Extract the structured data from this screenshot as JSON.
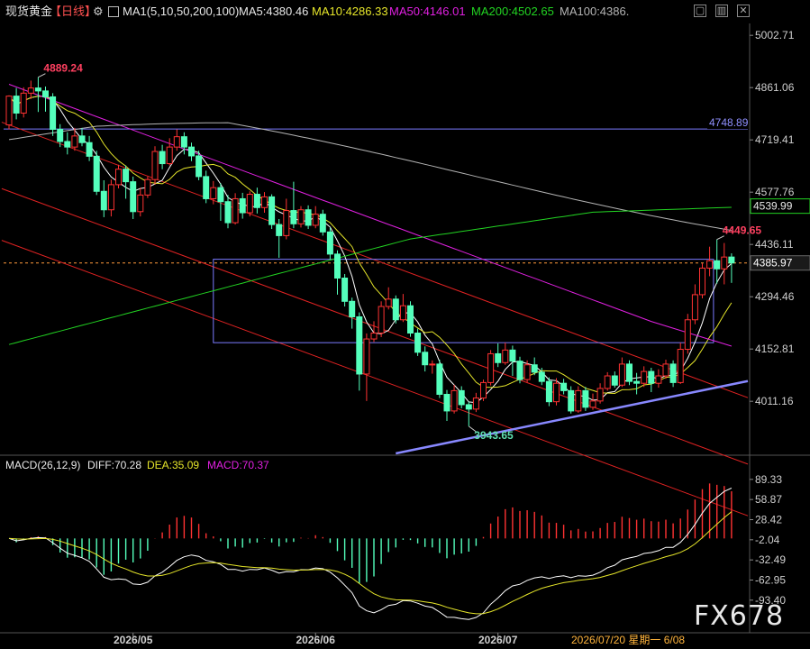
{
  "header": {
    "symbol": "现货黄金",
    "period": "【日线】",
    "gear_glyph": "⚙",
    "ma_main": "MA1(5,10,50,200,100)",
    "ma5": "MA5:4380.46",
    "ma10": "MA10:4286.33",
    "ma50": "MA50:4146.01",
    "ma200": "MA200:4502.65",
    "ma100": "MA100:4386."
  },
  "macd_header": {
    "title": "MACD(26,12,9)",
    "diff": "DIFF:70.28",
    "dea": "DEA:35.09",
    "macd": "MACD:70.37"
  },
  "watermark": "FX678",
  "colors": {
    "up": "#ff3232",
    "down": "#54ffbc",
    "ma5": "#ffffff",
    "ma10": "#e6e62a",
    "ma50": "#e020e0",
    "ma200": "#22d422",
    "ma100": "#b4b4b4",
    "channel": "#e02222",
    "support": "#8888ff",
    "box": "#7a7aff",
    "hline": "#7a7aff"
  },
  "chart_data": {
    "type": "candlestick",
    "title": "现货黄金 日线",
    "price_axis": {
      "ticks": [
        5002.71,
        4861.06,
        4719.41,
        4577.76,
        4436.11,
        4294.46,
        4152.81,
        4011.16
      ],
      "labels": [
        "5002.71",
        "4861.06",
        "4719.41",
        "4577.76",
        "4436.11",
        "4294.46",
        "4152.81",
        "4011.16"
      ],
      "range": [
        3870,
        5030
      ]
    },
    "macd_axis": {
      "ticks": [
        89.33,
        58.87,
        28.42,
        -2.04,
        -32.49,
        -62.95,
        -93.4
      ],
      "labels": [
        "89.33",
        "58.87",
        "28.42",
        "-2.04",
        "-32.49",
        "-62.95",
        "-93.40"
      ],
      "range": [
        -140,
        100
      ]
    },
    "x_labels": [
      "2026/05",
      "2026/06",
      "2026/07"
    ],
    "x_label_bars": [
      17,
      42,
      67
    ],
    "cursor_label": "2026/07/20 星期一 6/08",
    "current_price": {
      "value": 4385.97,
      "label": "4385.97"
    },
    "price_tags": [
      {
        "value": 4748.89,
        "label": "4748.89"
      },
      {
        "value": 4539.99,
        "label": "4539.99"
      }
    ],
    "annotations": [
      {
        "label": "4889.24",
        "bar": 4,
        "value": 4889.24,
        "kind": "high"
      },
      {
        "label": "4449.65",
        "bar": 97,
        "value": 4449.65,
        "kind": "high"
      },
      {
        "label": "3943.65",
        "bar": 63,
        "value": 3943.65,
        "kind": "low"
      }
    ],
    "horizontal_line": 4748.89,
    "box": {
      "bar_start": 28,
      "bar_end": 99,
      "low": 4170,
      "high": 4396
    },
    "candles": [
      [
        4760,
        4838,
        4840,
        4748
      ],
      [
        4838,
        4792,
        4860,
        4775
      ],
      [
        4792,
        4846,
        4862,
        4780
      ],
      [
        4846,
        4860,
        4880,
        4830
      ],
      [
        4860,
        4852,
        4889.24,
        4795
      ],
      [
        4852,
        4836,
        4864,
        4796
      ],
      [
        4836,
        4748,
        4846,
        4730
      ],
      [
        4748,
        4715,
        4762,
        4700
      ],
      [
        4715,
        4700,
        4740,
        4680
      ],
      [
        4700,
        4730,
        4752,
        4690
      ],
      [
        4730,
        4712,
        4752,
        4702
      ],
      [
        4712,
        4675,
        4730,
        4662
      ],
      [
        4675,
        4580,
        4690,
        4570
      ],
      [
        4580,
        4530,
        4610,
        4510
      ],
      [
        4530,
        4598,
        4612,
        4512
      ],
      [
        4598,
        4640,
        4652,
        4588
      ],
      [
        4640,
        4606,
        4650,
        4560
      ],
      [
        4606,
        4525,
        4620,
        4505
      ],
      [
        4525,
        4570,
        4590,
        4512
      ],
      [
        4570,
        4612,
        4620,
        4562
      ],
      [
        4612,
        4688,
        4702,
        4598
      ],
      [
        4688,
        4655,
        4706,
        4640
      ],
      [
        4655,
        4700,
        4724,
        4650
      ],
      [
        4700,
        4728,
        4748,
        4690
      ],
      [
        4728,
        4700,
        4740,
        4680
      ],
      [
        4700,
        4676,
        4712,
        4662
      ],
      [
        4676,
        4620,
        4690,
        4610
      ],
      [
        4620,
        4560,
        4636,
        4548
      ],
      [
        4560,
        4590,
        4608,
        4545
      ],
      [
        4590,
        4552,
        4602,
        4500
      ],
      [
        4552,
        4495,
        4570,
        4480
      ],
      [
        4495,
        4560,
        4575,
        4490
      ],
      [
        4560,
        4522,
        4576,
        4506
      ],
      [
        4522,
        4572,
        4580,
        4512
      ],
      [
        4572,
        4536,
        4590,
        4520
      ],
      [
        4536,
        4565,
        4578,
        4522
      ],
      [
        4565,
        4490,
        4572,
        4478
      ],
      [
        4490,
        4460,
        4505,
        4400
      ],
      [
        4460,
        4528,
        4560,
        4450
      ],
      [
        4528,
        4492,
        4606,
        4480
      ],
      [
        4492,
        4530,
        4540,
        4482
      ],
      [
        4530,
        4488,
        4542,
        4478
      ],
      [
        4488,
        4518,
        4540,
        4480
      ],
      [
        4518,
        4470,
        4530,
        4460
      ],
      [
        4470,
        4410,
        4482,
        4396
      ],
      [
        4410,
        4345,
        4420,
        4300
      ],
      [
        4345,
        4282,
        4356,
        4268
      ],
      [
        4282,
        4240,
        4292,
        4208
      ],
      [
        4240,
        4085,
        4252,
        4040
      ],
      [
        4085,
        4180,
        4195,
        4012
      ],
      [
        4180,
        4196,
        4228,
        4172
      ],
      [
        4196,
        4268,
        4282,
        4185
      ],
      [
        4268,
        4288,
        4320,
        4260
      ],
      [
        4288,
        4232,
        4298,
        4222
      ],
      [
        4232,
        4270,
        4302,
        4226
      ],
      [
        4270,
        4196,
        4282,
        4186
      ],
      [
        4196,
        4144,
        4208,
        4134
      ],
      [
        4144,
        4110,
        4160,
        4092
      ],
      [
        4110,
        4112,
        4122,
        4086
      ],
      [
        4112,
        4030,
        4124,
        4020
      ],
      [
        4030,
        3985,
        4042,
        3958
      ],
      [
        3985,
        4040,
        4056,
        3978
      ],
      [
        4040,
        4002,
        4052,
        3992
      ],
      [
        4002,
        3990,
        4010,
        3943.65
      ],
      [
        3990,
        4020,
        4034,
        3982
      ],
      [
        4020,
        4062,
        4070,
        4012
      ],
      [
        4062,
        4140,
        4150,
        4054
      ],
      [
        4140,
        4116,
        4168,
        4104
      ],
      [
        4116,
        4150,
        4170,
        4110
      ],
      [
        4150,
        4120,
        4162,
        4080
      ],
      [
        4120,
        4070,
        4132,
        4060
      ],
      [
        4070,
        4110,
        4122,
        4062
      ],
      [
        4110,
        4090,
        4130,
        4082
      ],
      [
        4090,
        4065,
        4102,
        4055
      ],
      [
        4065,
        4010,
        4076,
        3998
      ],
      [
        4010,
        4060,
        4074,
        4000
      ],
      [
        4060,
        4040,
        4072,
        4030
      ],
      [
        4040,
        3985,
        4052,
        3978
      ],
      [
        3985,
        4040,
        4052,
        3980
      ],
      [
        4040,
        3995,
        4050,
        3985
      ],
      [
        3995,
        4012,
        4032,
        3988
      ],
      [
        4012,
        4046,
        4060,
        4005
      ],
      [
        4046,
        4080,
        4090,
        4040
      ],
      [
        4080,
        4055,
        4092,
        4048
      ],
      [
        4055,
        4112,
        4130,
        4050
      ],
      [
        4112,
        4065,
        4122,
        4055
      ],
      [
        4065,
        4060,
        4088,
        4030
      ],
      [
        4060,
        4092,
        4106,
        4050
      ],
      [
        4092,
        4060,
        4102,
        4036
      ],
      [
        4060,
        4080,
        4098,
        4048
      ],
      [
        4080,
        4112,
        4124,
        4072
      ],
      [
        4112,
        4062,
        4122,
        4050
      ],
      [
        4062,
        4152,
        4170,
        4058
      ],
      [
        4152,
        4232,
        4248,
        4140
      ],
      [
        4232,
        4300,
        4328,
        4220
      ],
      [
        4300,
        4372,
        4385,
        4290
      ],
      [
        4372,
        4392,
        4430,
        4350
      ],
      [
        4392,
        4370,
        4449.65,
        4330
      ],
      [
        4370,
        4402,
        4440,
        4328
      ],
      [
        4402,
        4385.97,
        4412,
        4332
      ]
    ]
  }
}
